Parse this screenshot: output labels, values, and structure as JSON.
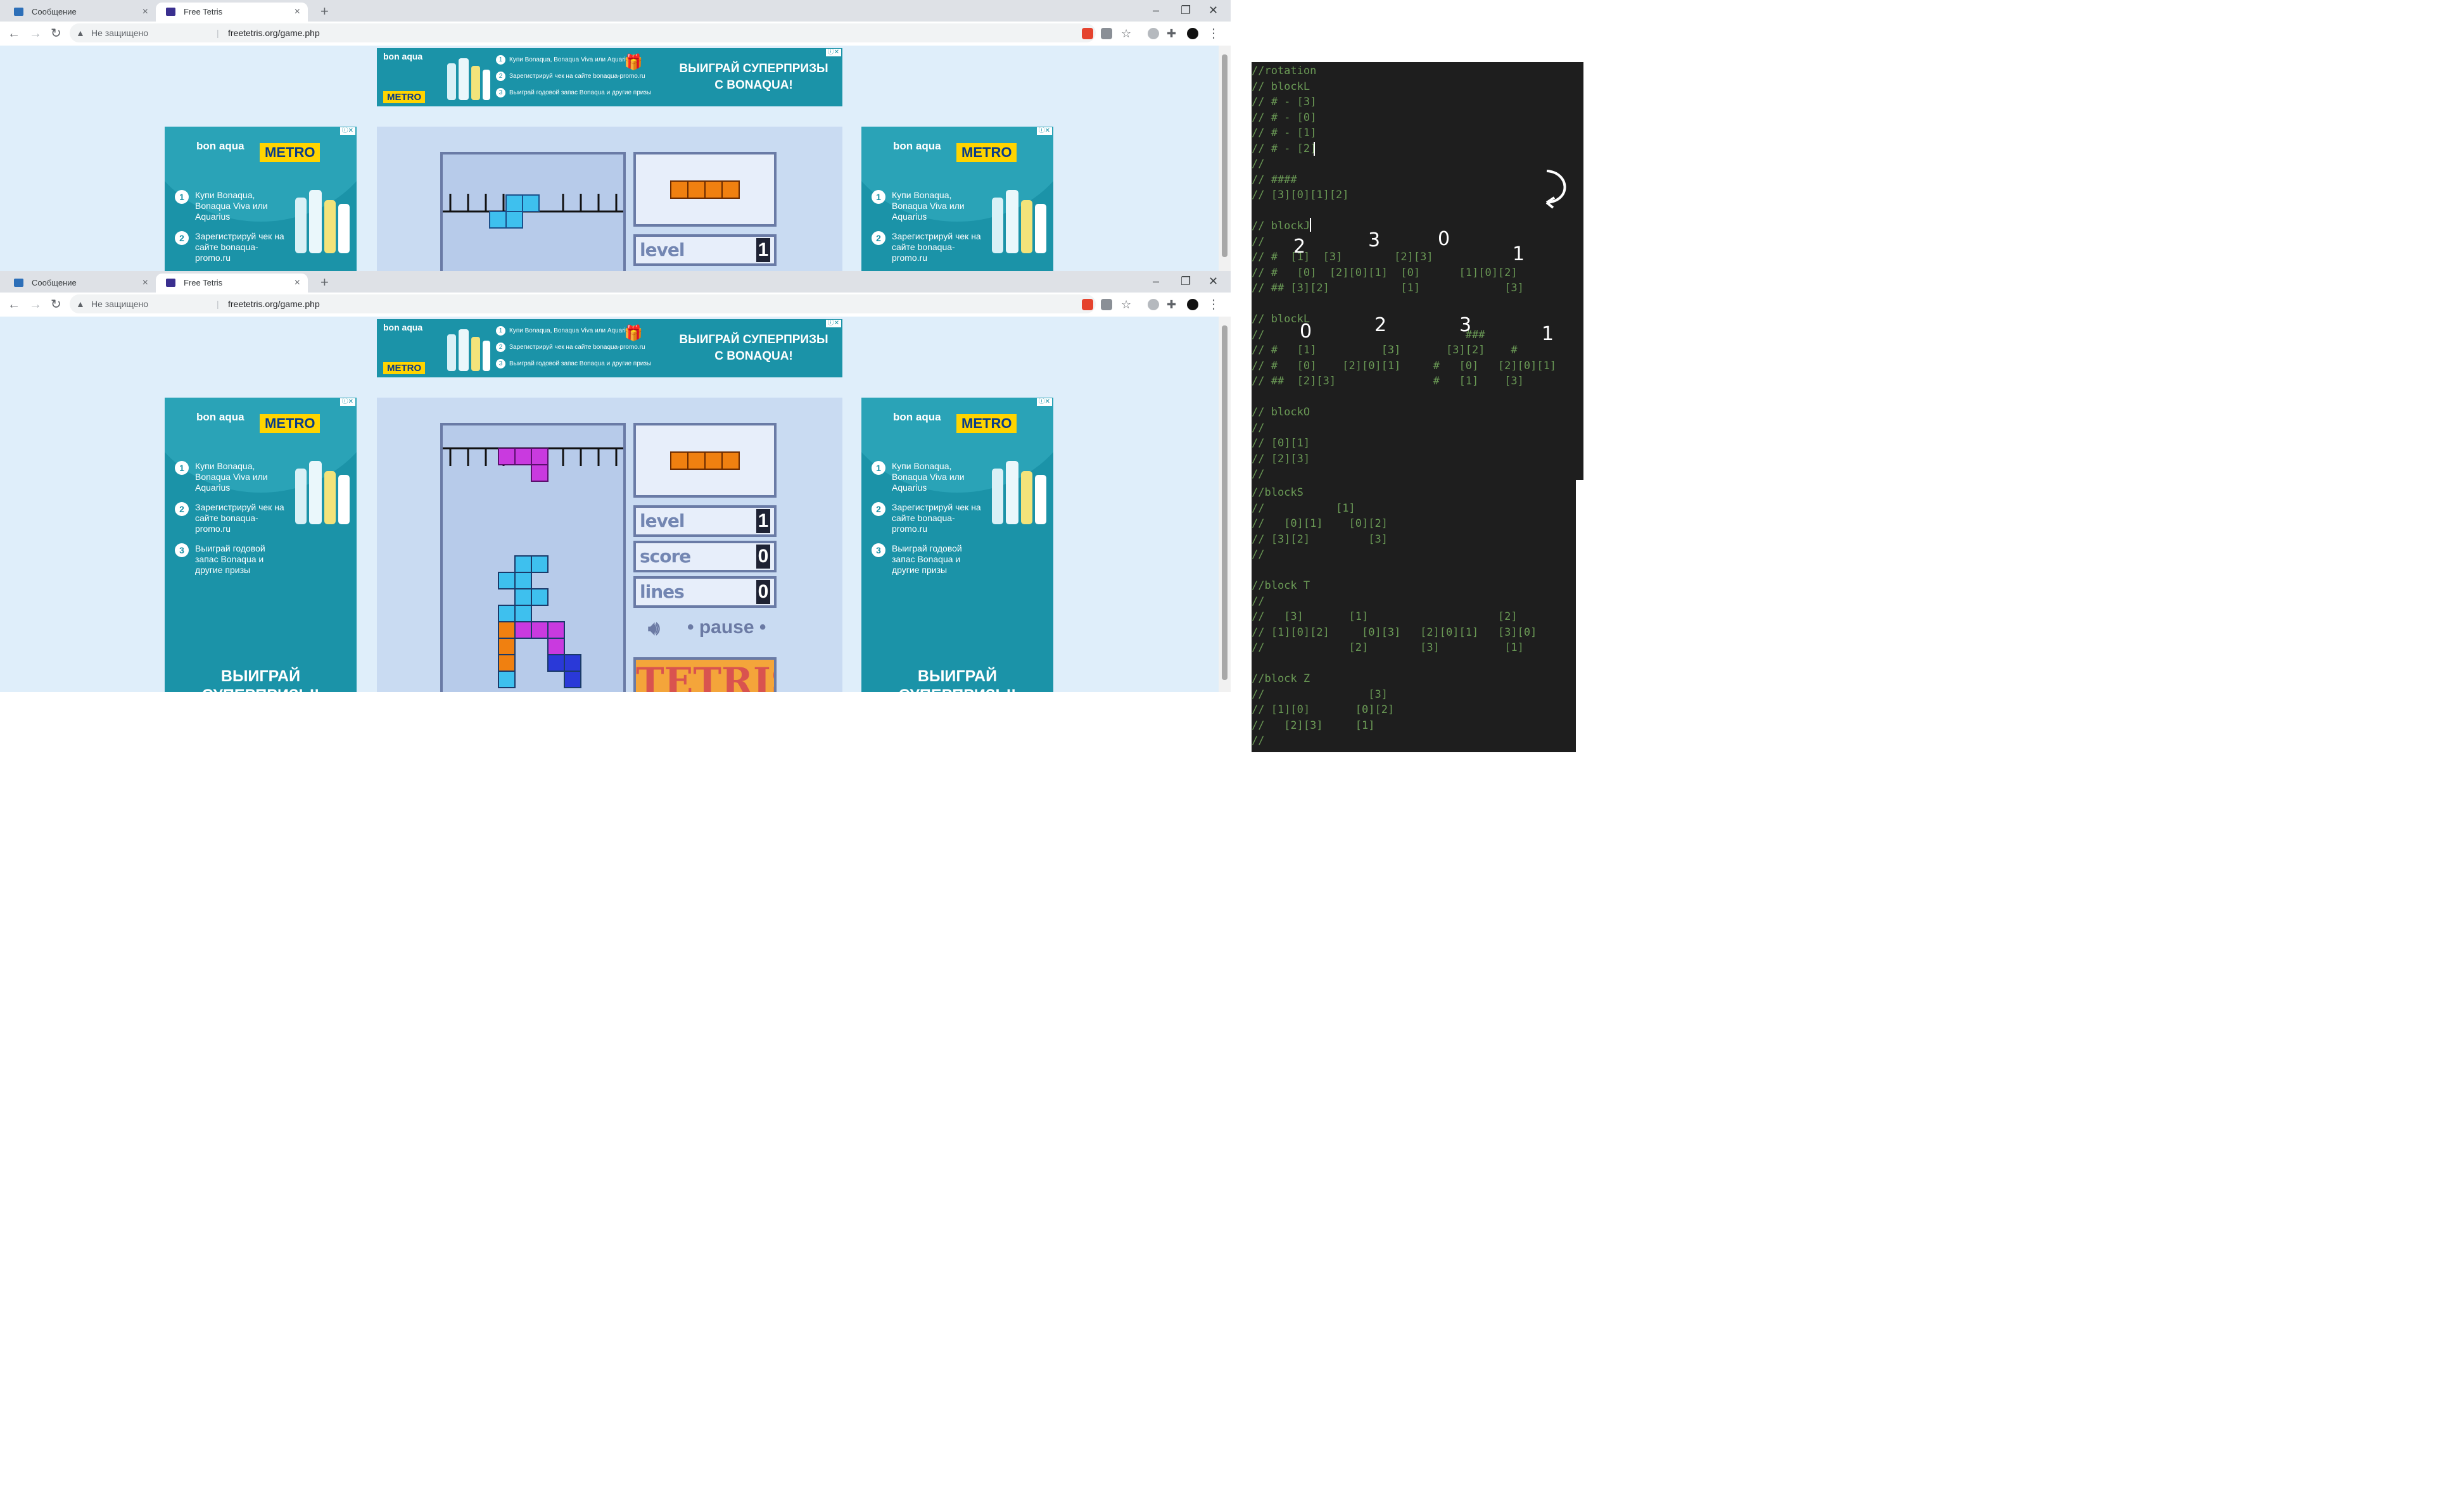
{
  "windows": [
    {
      "tabs": [
        {
          "label": "Сообщение",
          "active": false
        },
        {
          "label": "Free Tetris",
          "active": true
        }
      ],
      "address": {
        "security": "Не защищено",
        "url": "freetetris.org/game.php"
      },
      "game": {
        "stats": [
          {
            "label": "level",
            "value": "1"
          }
        ],
        "preview_piece": "I"
      }
    },
    {
      "tabs": [
        {
          "label": "Сообщение",
          "active": false
        },
        {
          "label": "Free Tetris",
          "active": true
        }
      ],
      "address": {
        "security": "Не защищено",
        "url": "freetetris.org/game.php"
      },
      "game": {
        "stats": [
          {
            "label": "level",
            "value": "1"
          },
          {
            "label": "score",
            "value": "0"
          },
          {
            "label": "lines",
            "value": "0"
          }
        ],
        "pause_label": "• pause •",
        "logo": "TETRIS",
        "preview_piece": "I"
      }
    }
  ],
  "ads": {
    "banner": {
      "logo": "bon aqua",
      "metro": "METRO",
      "steps": [
        "Купи Bonaqua, Bonaqua Viva или Aquarius",
        "Зарегистрируй чек на сайте bonaqua-promo.ru",
        "Выиграй годовой запас Bonaqua и другие призы"
      ],
      "cta_line1": "ВЫИГРАЙ СУПЕРПРИЗЫ",
      "cta_line2": "С BONAQUA!"
    },
    "side": {
      "logo": "bon aqua",
      "metro": "METRO",
      "step1": "Купи Bonaqua, Bonaqua Viva или Aquarius",
      "step2": "Зарегистрируй чек на сайте bonaqua-promo.ru",
      "step3": "Выиграй годовой запас Bonaqua и другие призы",
      "cta_line1": "ВЫИГРАЙ",
      "cta_line2": "СУПЕРПРИЗЫ!"
    }
  },
  "colors": {
    "piece_i": "#f08010",
    "piece_cyan": "#3ec0ee",
    "piece_magenta": "#c93adf",
    "piece_blue": "#2a39d8",
    "well_bg": "#b7cbea",
    "ad_bg": "#1b93a8",
    "editor_bg": "#1e1e1e",
    "comment": "#6a9955"
  },
  "editor_panels": [
    {
      "lines": [
        "//rotation",
        "// blockL",
        "// # - [3]",
        "// # - [0]",
        "// # - [1]",
        "// # - [2]",
        "//",
        "// ####",
        "// [3][0][1][2]",
        "",
        "// blockJ",
        "//",
        "// #  [1]  [3]        [2][3]",
        "// #   [0]  [2][0][1]  [0]      [1][0][2]",
        "// ## [3][2]           [1]             [3]",
        "",
        "// blockL",
        "//                               ###",
        "// #   [1]          [3]       [3][2]    #",
        "// #   [0]    [2][0][1]     #   [0]   [2][0][1]",
        "// ##  [2][3]               #   [1]    [3]",
        "",
        "// blockO",
        "//",
        "// [0][1]",
        "// [2][3]",
        "//"
      ]
    },
    {
      "lines": [
        "//blockS",
        "//           [1]",
        "//   [0][1]    [0][2]",
        "// [3][2]         [3]",
        "//",
        "",
        "//block T",
        "//",
        "//   [3]       [1]                    [2]",
        "// [1][0][2]     [0][3]   [2][0][1]   [3][0]",
        "//             [2]        [3]          [1]",
        "",
        "//block Z",
        "//                [3]",
        "// [1][0]       [0][2]",
        "//   [2][3]     [1]",
        "//"
      ]
    }
  ],
  "handwriting": [
    "2",
    "3",
    "0",
    "1",
    "0",
    "2",
    "3",
    "1"
  ]
}
